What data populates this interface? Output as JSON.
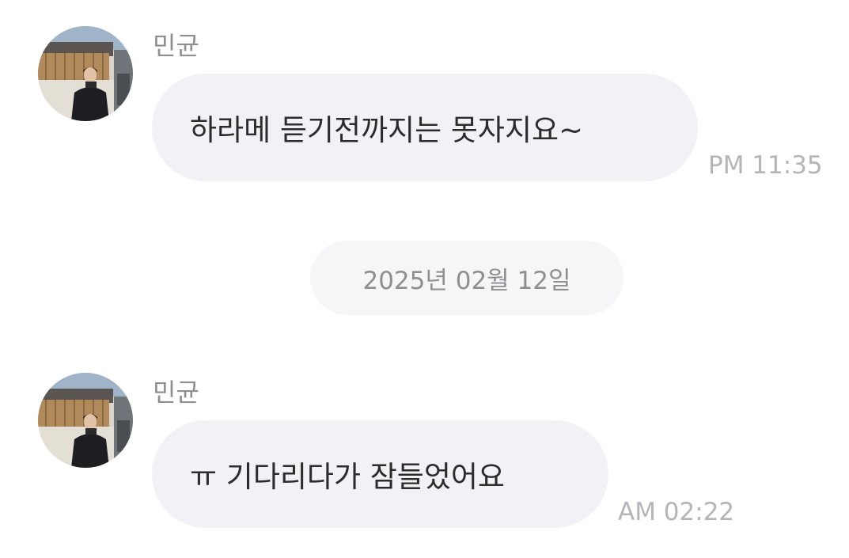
{
  "messages": [
    {
      "sender": "민균",
      "text": "하라메 듣기전까지는 못자지요~",
      "time": "PM 11:35",
      "avatar_icon": "profile-photo"
    },
    {
      "sender": "민균",
      "text": "ㅠ 기다리다가 잠들었어요",
      "time": "AM 02:22",
      "avatar_icon": "profile-photo"
    }
  ],
  "date_separator": "2025년 02월 12일",
  "colors": {
    "bubble": "#f2f2f6",
    "date_pill": "#f6f6f9",
    "sender_text": "#8e8e93",
    "time_text": "#b4b4b9",
    "message_text": "#2c2c2e"
  }
}
